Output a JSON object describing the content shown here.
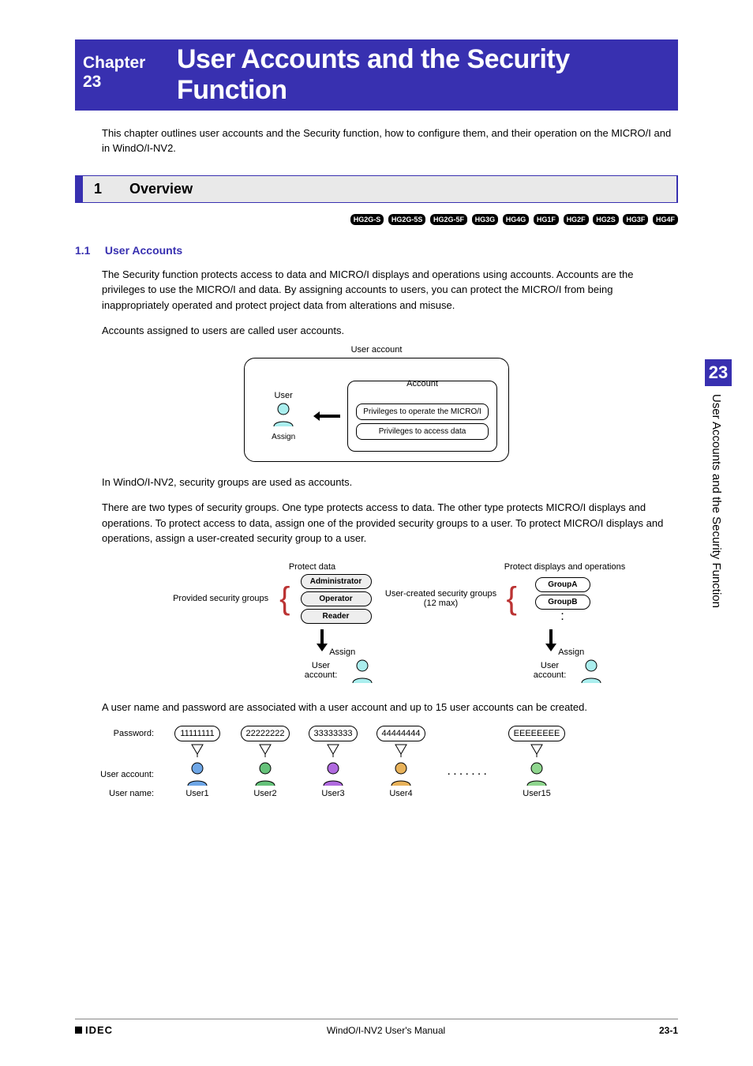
{
  "chapter": {
    "label": "Chapter 23",
    "title": "User Accounts and the Security Function"
  },
  "intro": "This chapter outlines user accounts and the Security function, how to configure them, and their operation on the MICRO/I and in WindO/I-NV2.",
  "section": {
    "num": "1",
    "title": "Overview"
  },
  "badges": [
    "HG2G-S",
    "HG2G-5S",
    "HG2G-5F",
    "HG3G",
    "HG4G",
    "HG1F",
    "HG2F",
    "HG2S",
    "HG3F",
    "HG4F"
  ],
  "sub": {
    "num": "1.1",
    "title": "User Accounts"
  },
  "p1": "The Security function protects access to data and MICRO/I displays and operations using accounts. Accounts are the privileges to use the MICRO/I and data. By assigning accounts to users, you can protect the MICRO/I from being inappropriately operated and protect project data from alterations and misuse.",
  "p2": "Accounts assigned to users are called user accounts.",
  "diag1": {
    "outer": "User account",
    "user": "User",
    "assign": "Assign",
    "inner": "Account",
    "priv1": "Privileges to operate the MICRO/I",
    "priv2": "Privileges to access data"
  },
  "p3": "In WindO/I-NV2, security groups are used as accounts.",
  "p4": "There are two types of security groups. One type protects access to data. The other type protects MICRO/I displays and operations. To protect access to data, assign one of the provided security groups to a user. To protect MICRO/I displays and operations, assign a user-created security group to a user.",
  "diag2": {
    "h1": "Protect data",
    "h2": "Protect displays and operations",
    "left": "Provided security groups",
    "roles": [
      "Administrator",
      "Operator",
      "Reader"
    ],
    "mid": "User-created security groups (12 max)",
    "groups": [
      "GroupA",
      "GroupB"
    ],
    "assign": "Assign",
    "ua": "User account:"
  },
  "p5": "A user name and password are associated with a user account and up to 15 user accounts can be created.",
  "diag3": {
    "labels": {
      "pw": "Password:",
      "ua": "User account:",
      "un": "User name:"
    },
    "cols": [
      {
        "pw": "11111111",
        "un": "User1",
        "c": "#6ea6e6"
      },
      {
        "pw": "22222222",
        "un": "User2",
        "c": "#66c27a"
      },
      {
        "pw": "33333333",
        "un": "User3",
        "c": "#b06adf"
      },
      {
        "pw": "44444444",
        "un": "User4",
        "c": "#e8b25a"
      }
    ],
    "last": {
      "pw": "EEEEEEEE",
      "un": "User15",
      "c": "#8fd68e"
    }
  },
  "tab": {
    "num": "23",
    "title": "User Accounts and the Security Function"
  },
  "footer": {
    "logo": "IDEC",
    "center": "WindO/I-NV2 User's Manual",
    "page": "23-1"
  }
}
